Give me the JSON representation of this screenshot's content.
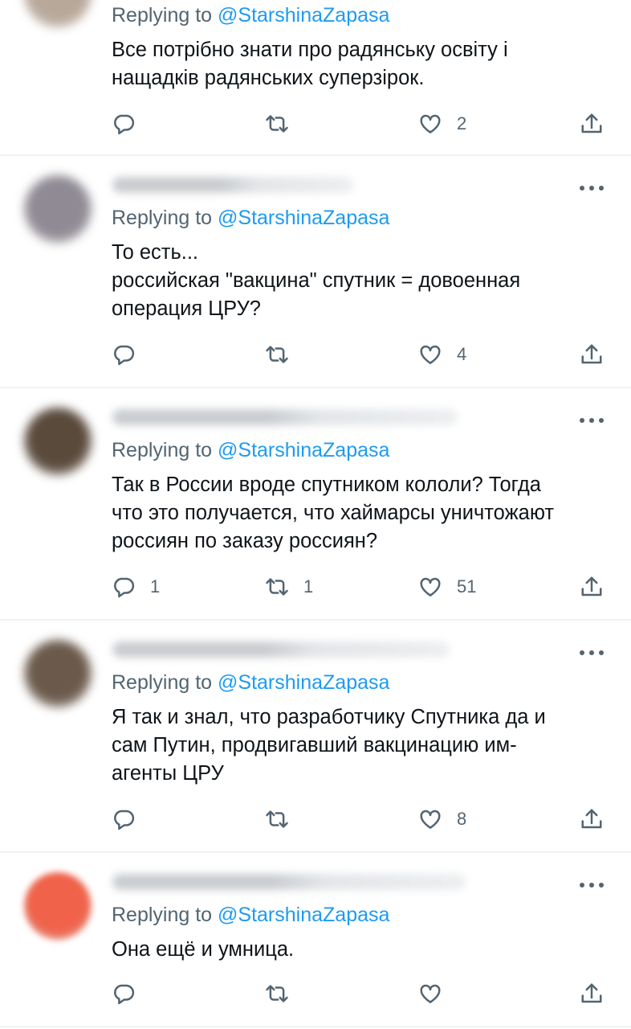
{
  "reply_prefix": "Replying to",
  "tweets": [
    {
      "handle": "@StarshinaZapasa",
      "text": "Все потрібно знати про радянську освіту і\nнащадків радянських суперзірок.",
      "replies": "",
      "retweets": "",
      "likes": "2",
      "avatar_color": "#b8a89a"
    },
    {
      "handle": "@StarshinaZapasa",
      "text": "То есть...\nроссийская \"вакцина\" спутник = довоенная\nоперация ЦРУ?",
      "replies": "",
      "retweets": "",
      "likes": "4",
      "avatar_color": "#8f8a94"
    },
    {
      "handle": "@StarshinaZapasa",
      "text": "Так в России вроде спутником кололи? Тогда\nчто это получается, что хаймарсы уничтожают\nроссиян по заказу россиян?",
      "replies": "1",
      "retweets": "1",
      "likes": "51",
      "avatar_color": "#5a4a3c"
    },
    {
      "handle": "@StarshinaZapasa",
      "text": "Я так и знал, что разработчику Спутника да и\nсам Путин, продвигавший вакцинацию им-\nагенты ЦРУ",
      "replies": "",
      "retweets": "",
      "likes": "8",
      "avatar_color": "#6b5a4c"
    },
    {
      "handle": "@StarshinaZapasa",
      "text": "Она ещё и умница.",
      "replies": "",
      "retweets": "",
      "likes": "",
      "avatar_color": "#f0624a"
    }
  ]
}
